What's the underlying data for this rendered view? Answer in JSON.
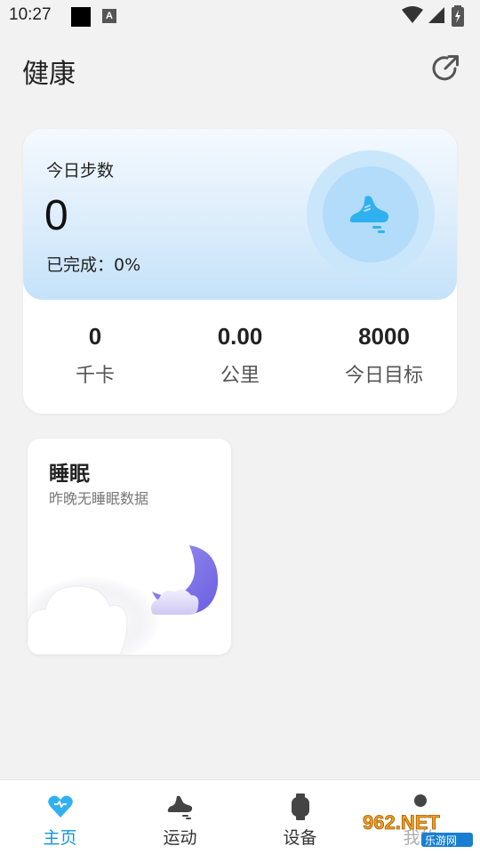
{
  "status_bar": {
    "time": "10:27",
    "notification_letter": "A"
  },
  "header": {
    "title": "健康"
  },
  "steps_card": {
    "label": "今日步数",
    "value": "0",
    "complete_text": "已完成：0%",
    "progress_fraction": 0,
    "accent_color": "#2fb1f0",
    "stats": [
      {
        "value": "0",
        "unit": "千卡"
      },
      {
        "value": "0.00",
        "unit": "公里"
      },
      {
        "value": "8000",
        "unit": "今日目标"
      }
    ]
  },
  "sleep_card": {
    "title": "睡眠",
    "subtitle": "昨晚无睡眠数据",
    "moon_color": "#7b6ee8"
  },
  "bottom_nav": {
    "items": [
      {
        "label": "主页",
        "icon": "heart-icon",
        "active": true
      },
      {
        "label": "运动",
        "icon": "sneaker-icon",
        "active": false
      },
      {
        "label": "设备",
        "icon": "watch-icon",
        "active": false
      },
      {
        "label": "我的",
        "icon": "person-icon",
        "active": false
      }
    ],
    "active_color": "#1296db"
  },
  "watermark": {
    "text_top": "962.NET",
    "text_bottom": "乐游网"
  }
}
